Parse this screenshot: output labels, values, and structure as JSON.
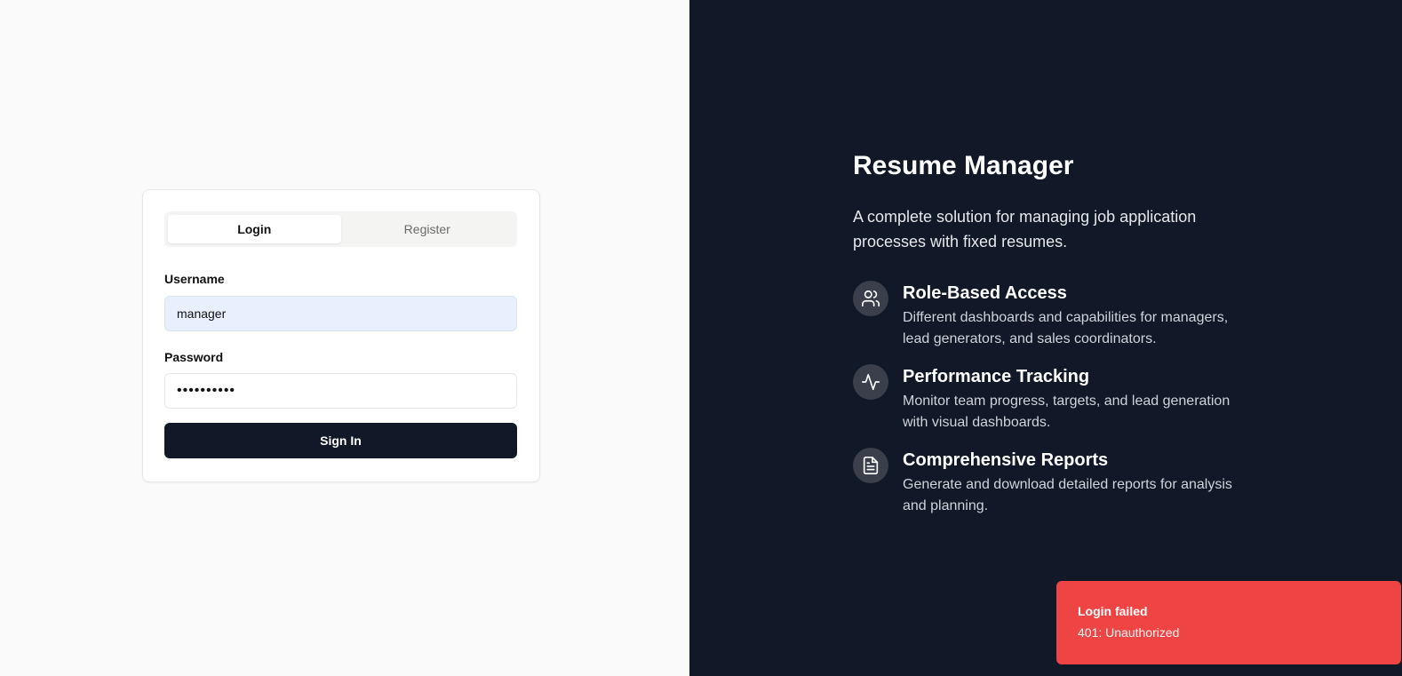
{
  "auth": {
    "tabs": [
      {
        "label": "Login",
        "active": true
      },
      {
        "label": "Register",
        "active": false
      }
    ],
    "username_label": "Username",
    "username_value": "manager",
    "password_label": "Password",
    "password_value": "••••••••••",
    "submit_label": "Sign In"
  },
  "hero": {
    "title": "Resume Manager",
    "description": "A complete solution for managing job application processes with fixed resumes.",
    "features": [
      {
        "icon": "users-icon",
        "title": "Role-Based Access",
        "description": "Different dashboards and capabilities for managers, lead generators, and sales coordinators."
      },
      {
        "icon": "activity-icon",
        "title": "Performance Tracking",
        "description": "Monitor team progress, targets, and lead generation with visual dashboards."
      },
      {
        "icon": "file-text-icon",
        "title": "Comprehensive Reports",
        "description": "Generate and download detailed reports for analysis and planning."
      }
    ]
  },
  "toast": {
    "title": "Login failed",
    "message": "401: Unauthorized"
  },
  "colors": {
    "left_bg": "#fafafa",
    "right_bg": "#111827",
    "primary": "#111827",
    "toast_bg": "#ef4444",
    "autofill_bg": "#e8f0fe"
  }
}
